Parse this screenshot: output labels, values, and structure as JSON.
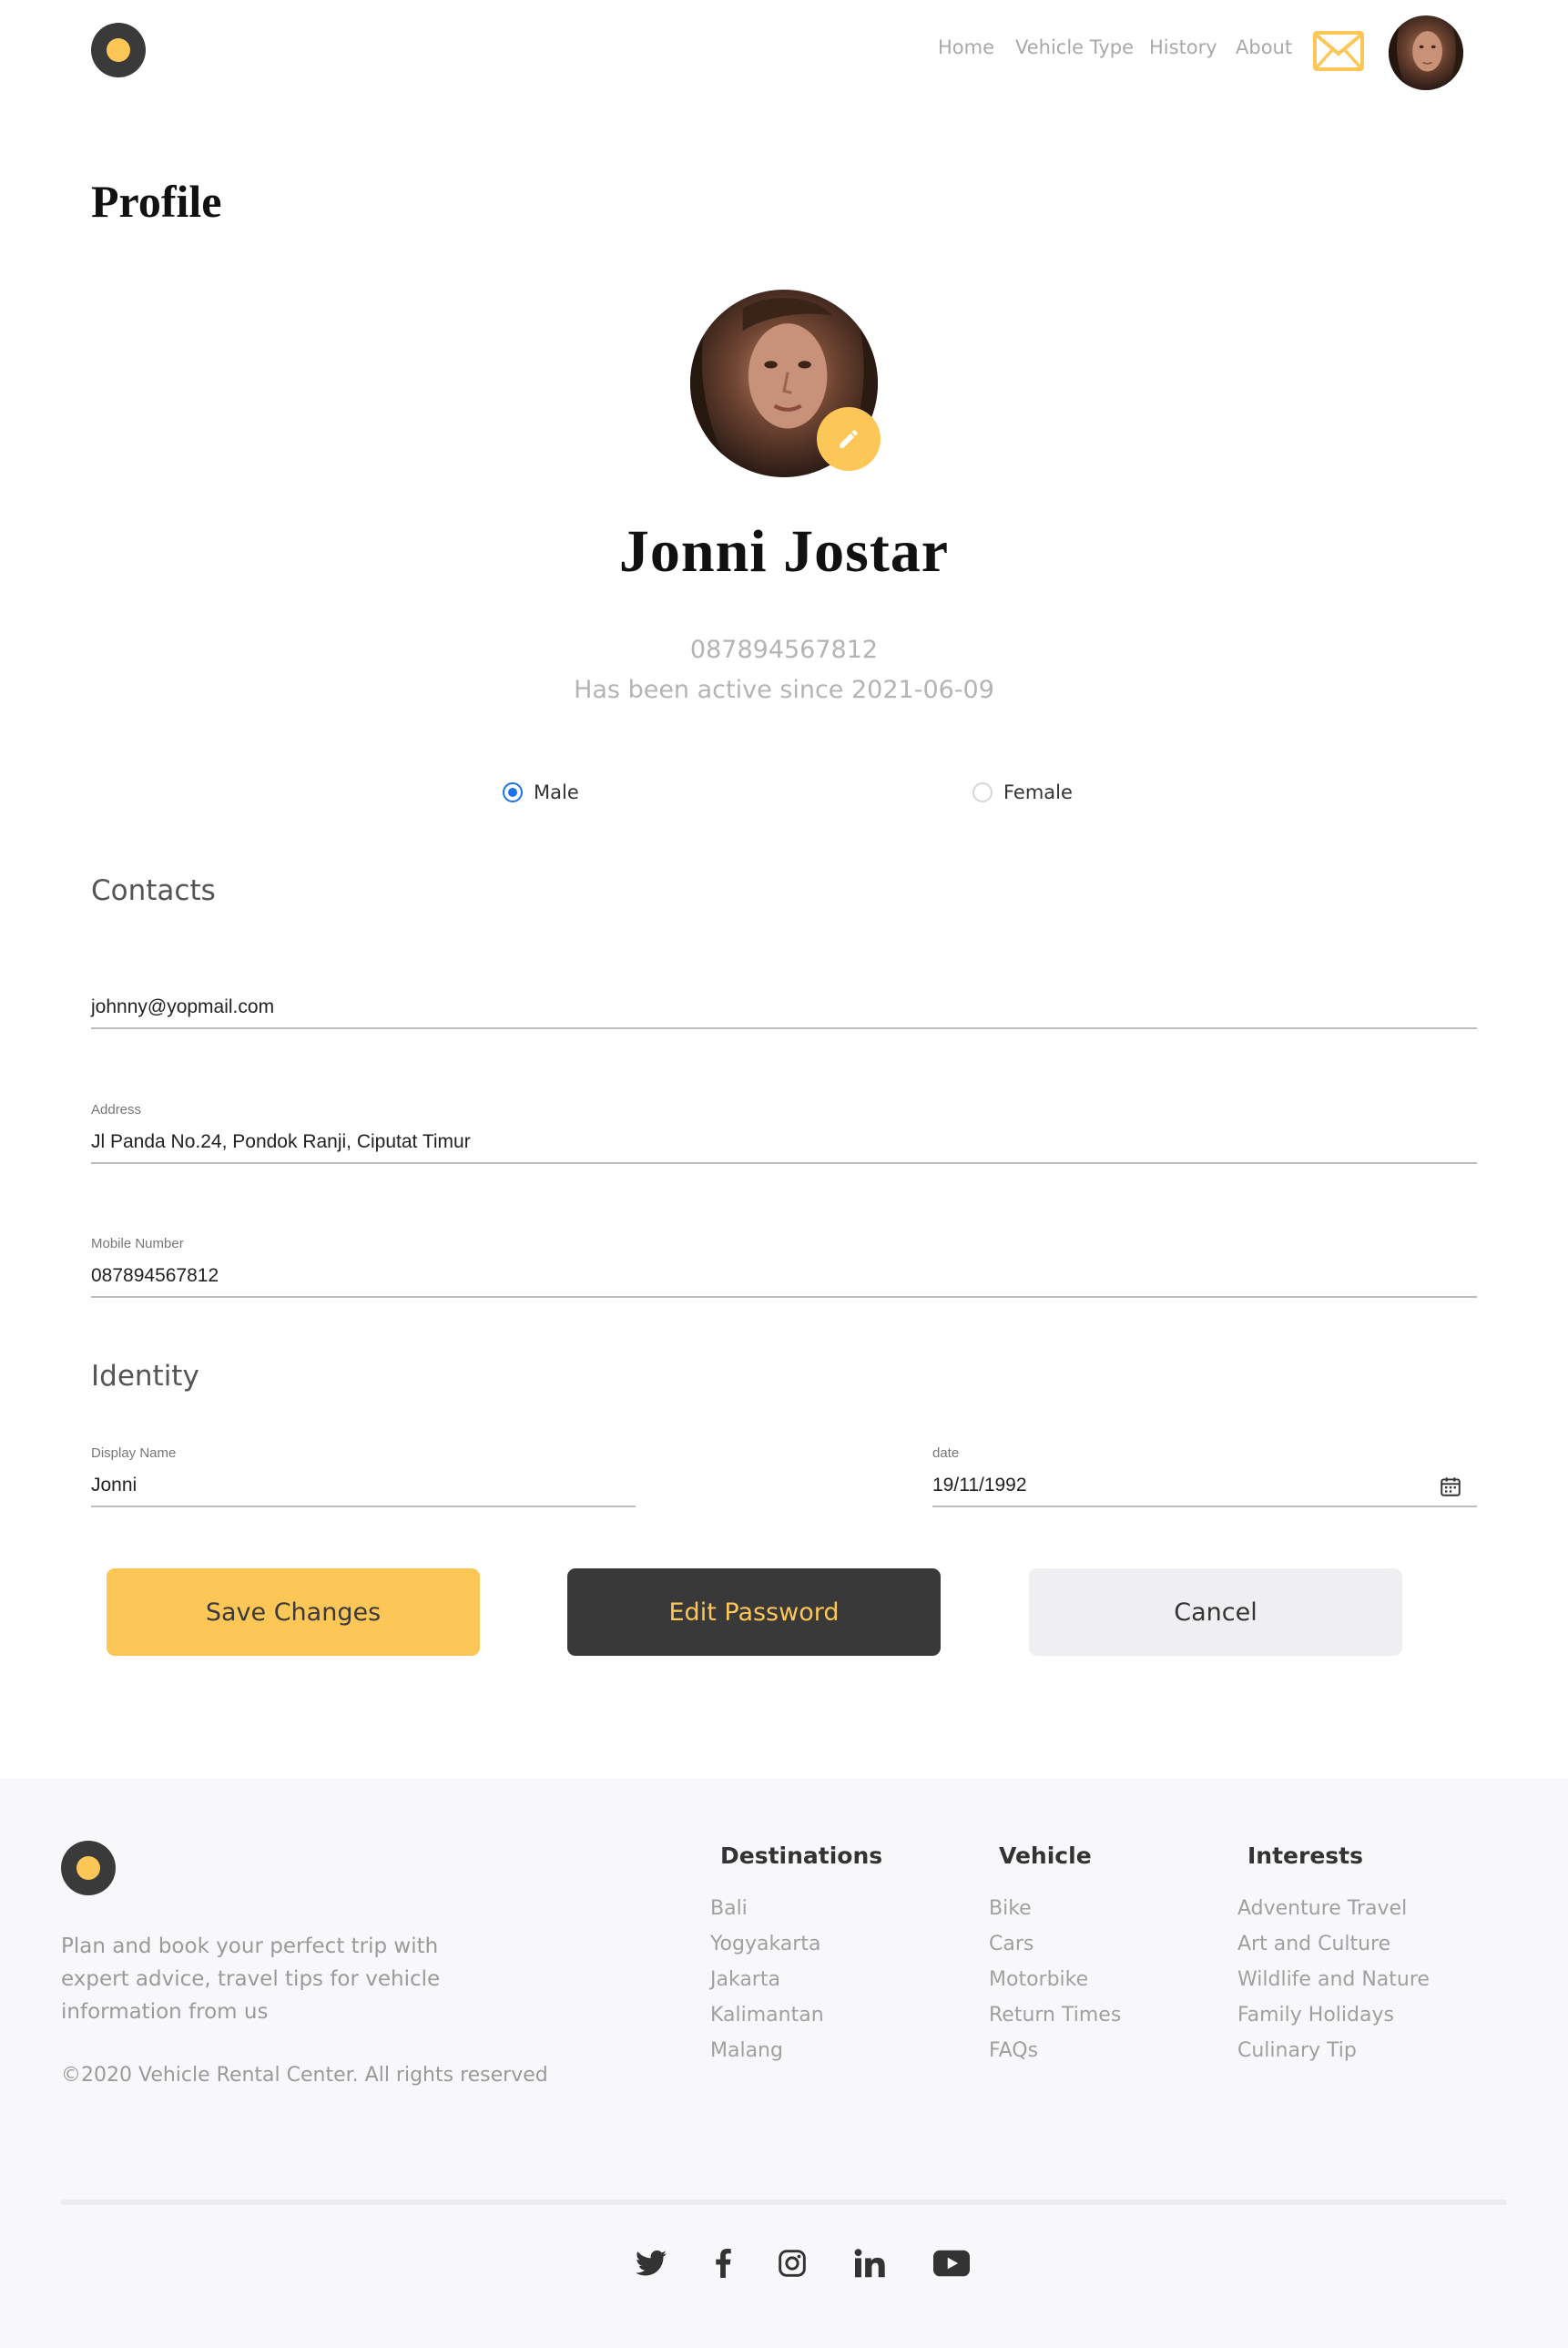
{
  "nav": {
    "links": [
      "Home",
      "Vehicle Type",
      "History",
      "About"
    ]
  },
  "profile": {
    "page_title": "Profile",
    "name": "Jonni Jostar",
    "phone": "087894567812",
    "active_since": "Has been active since 2021-06-09",
    "gender": {
      "options": [
        "Male",
        "Female"
      ],
      "selected": "Male"
    }
  },
  "contacts": {
    "section_title": "Contacts",
    "email": {
      "label": "",
      "value": "johnny@yopmail.com"
    },
    "address": {
      "label": "Address",
      "value": "Jl Panda No.24, Pondok Ranji, Ciputat Timur"
    },
    "mobile": {
      "label": "Mobile Number",
      "value": "087894567812"
    }
  },
  "identity": {
    "section_title": "Identity",
    "display_name": {
      "label": "Display Name",
      "value": "Jonni"
    },
    "date": {
      "label": "date",
      "value": "19/11/1992"
    }
  },
  "buttons": {
    "save": "Save Changes",
    "edit_password": "Edit Password",
    "cancel": "Cancel"
  },
  "footer": {
    "description": "Plan and book your perfect trip with expert advice, travel tips for vehicle information from us",
    "copyright": "©2020 Vehicle Rental Center. All rights reserved",
    "columns": [
      {
        "title": "Destinations",
        "items": [
          "Bali",
          "Yogyakarta",
          "Jakarta",
          "Kalimantan",
          "Malang"
        ]
      },
      {
        "title": "Vehicle",
        "items": [
          "Bike",
          "Cars",
          "Motorbike",
          "Return Times",
          "FAQs"
        ]
      },
      {
        "title": "Interests",
        "items": [
          "Adventure Travel",
          "Art and Culture",
          "Wildlife and Nature",
          "Family Holidays",
          "Culinary Tip"
        ]
      }
    ],
    "socials": [
      "twitter-icon",
      "facebook-icon",
      "instagram-icon",
      "linkedin-icon",
      "youtube-icon"
    ]
  },
  "colors": {
    "accent": "#fcc757",
    "dark": "#393939",
    "radio": "#1a73e8",
    "muted": "#b4b4b4"
  }
}
